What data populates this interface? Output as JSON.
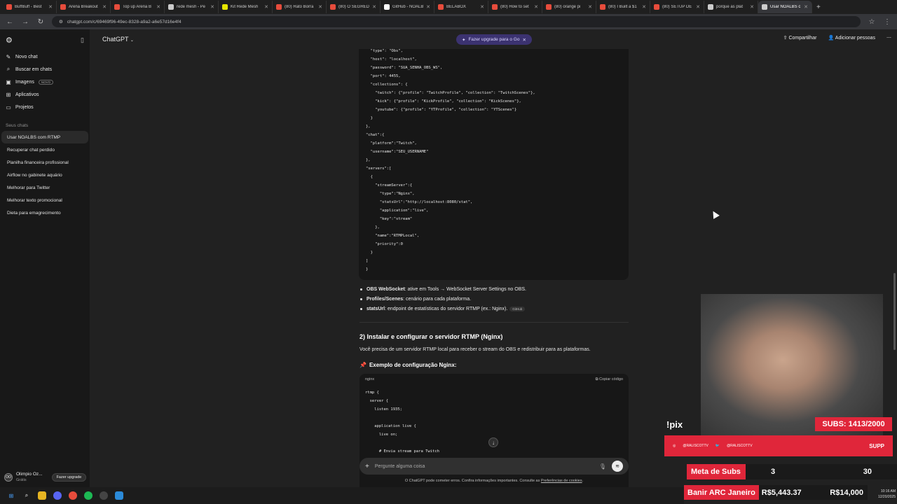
{
  "browser": {
    "tabs": [
      {
        "title": "BuffBuff - Best",
        "color": "#e74c3c"
      },
      {
        "title": "Arena Breakout",
        "color": "#e74c3c"
      },
      {
        "title": "Top up Arena B",
        "color": "#e74c3c"
      },
      {
        "title": "rede mesh - Pe",
        "color": "#cccccc"
      },
      {
        "title": "Kit Rede Mesh",
        "color": "#e6e600"
      },
      {
        "title": "(80) Rato Borra",
        "color": "#e74c3c"
      },
      {
        "title": "(80) O SEGREDO",
        "color": "#e74c3c"
      },
      {
        "title": "GitHub - NOALB",
        "color": "#ffffff"
      },
      {
        "title": "BELABOX",
        "color": "#e74c3c"
      },
      {
        "title": "(80) How to set",
        "color": "#e74c3c"
      },
      {
        "title": "(80) orange pi",
        "color": "#e74c3c"
      },
      {
        "title": "(80) I Built a $1",
        "color": "#e74c3c"
      },
      {
        "title": "(80) SETUP DE",
        "color": "#e74c3c"
      },
      {
        "title": "porque as plat",
        "color": "#cccccc"
      },
      {
        "title": "Usar NOALBS c",
        "color": "#cccccc"
      }
    ],
    "url": "chatgpt.com/c/69469f96-49ec-8328-a9a2-a6e57d16e4f4"
  },
  "sidebar": {
    "items": [
      {
        "icon": "new-chat-icon",
        "glyph": "✎",
        "label": "Novo chat"
      },
      {
        "icon": "search-icon",
        "glyph": "⌕",
        "label": "Buscar em chats"
      },
      {
        "icon": "image-icon",
        "glyph": "▣",
        "label": "Imagens",
        "badge": "NOVO"
      },
      {
        "icon": "apps-icon",
        "glyph": "⊞",
        "label": "Aplicativos"
      },
      {
        "icon": "folder-icon",
        "glyph": "▭",
        "label": "Projetos"
      }
    ],
    "section_title": "Seus chats",
    "chats": [
      "Usar NOALBS com RTMP",
      "Recuperar chat perdido",
      "Planilha financeira profissional",
      "Airflow no gabinete aquário",
      "Melhorar para Twitter",
      "Melhorar texto promocional",
      "Dieta para emagrecimento"
    ],
    "user": {
      "initials": "OO",
      "name": "Olimpio Oz...",
      "plan": "Grátis",
      "upgrade": "Fazer upgrade"
    }
  },
  "header": {
    "model": "ChatGPT",
    "upgrade_pill": "Fazer upgrade para o Go",
    "share": "Compartilhar",
    "add_people": "Adicionar pessoas"
  },
  "code1": [
    "  \"type\": \"Obs\",",
    "  \"host\": \"localhost\",",
    "  \"password\": \"SUA_SENHA_OBS_WS\",",
    "  \"port\": 4455,",
    "  \"collections\": {",
    "    \"twitch\": {\"profile\": \"TwitchProfile\", \"collection\": \"TwitchScenes\"},",
    "    \"kick\": {\"profile\": \"KickProfile\", \"collection\": \"KickScenes\"},",
    "    \"youtube\": {\"profile\": \"YTProfile\", \"collection\": \"YTScenes\"}",
    "  }",
    "},",
    "\"chat\":{",
    "  \"platform\":\"Twitch\",",
    "  \"username\":\"SEU_USERNAME\"",
    "},",
    "\"servers\":[",
    "  {",
    "    \"streamServer\":{",
    "      \"type\":\"Nginx\",",
    "      \"statsUrl\":\"http://localhost:8080/stat\",",
    "      \"application\":\"live\",",
    "      \"key\":\"stream\"",
    "    },",
    "    \"name\":\"RTMPLocal\",",
    "    \"priority\":0",
    "  }",
    "]",
    "}"
  ],
  "bullets": [
    {
      "bold": "OBS WebSocket",
      "text": ": ative em Tools → WebSocket Server Settings no OBS."
    },
    {
      "bold": "Profiles/Scenes",
      "text": ": cenário para cada plataforma."
    },
    {
      "bold": "statsUrl",
      "text": ": endpoint de estatísticas do servidor RTMP (ex.: Nginx).",
      "source": "GitHub"
    }
  ],
  "section2": {
    "title": "2) Instalar e configurar o servidor RTMP (Nginx)",
    "paragraph": "Você precisa de um servidor RTMP local para receber o stream do OBS e redistribuir para as plataformas.",
    "subtitle": "Exemplo de configuração Nginx:",
    "code_lang": "nginx",
    "copy_label": "Copiar código",
    "code": [
      "rtmp {",
      "  server {",
      "    listen 1935;",
      "",
      "    application live {",
      "      live on;",
      "",
      "      # Envia stream para Twitch"
    ]
  },
  "composer": {
    "placeholder": "Pergunte alguma coisa"
  },
  "disclaimer": {
    "text": "O ChatGPT pode cometer erros. Confira informações importantes. Consulte as ",
    "link": "Preferências de cookies",
    "end": "."
  },
  "overlay": {
    "pix": "!pix",
    "subs": "SUBS: 1413/2000",
    "instagram": "@RALISCOTTV",
    "twitter": "@RALISCOTTV",
    "brand": "SUPP",
    "meta_label": "Meta de Subs",
    "meta_current": "3",
    "meta_goal": "30",
    "ban_label": "Banir ARC Janeiro",
    "ban_current": "R$5,443.37",
    "ban_goal": "R$14,000"
  },
  "clock": {
    "time": "10:16 AM",
    "date": "12/20/2025"
  }
}
